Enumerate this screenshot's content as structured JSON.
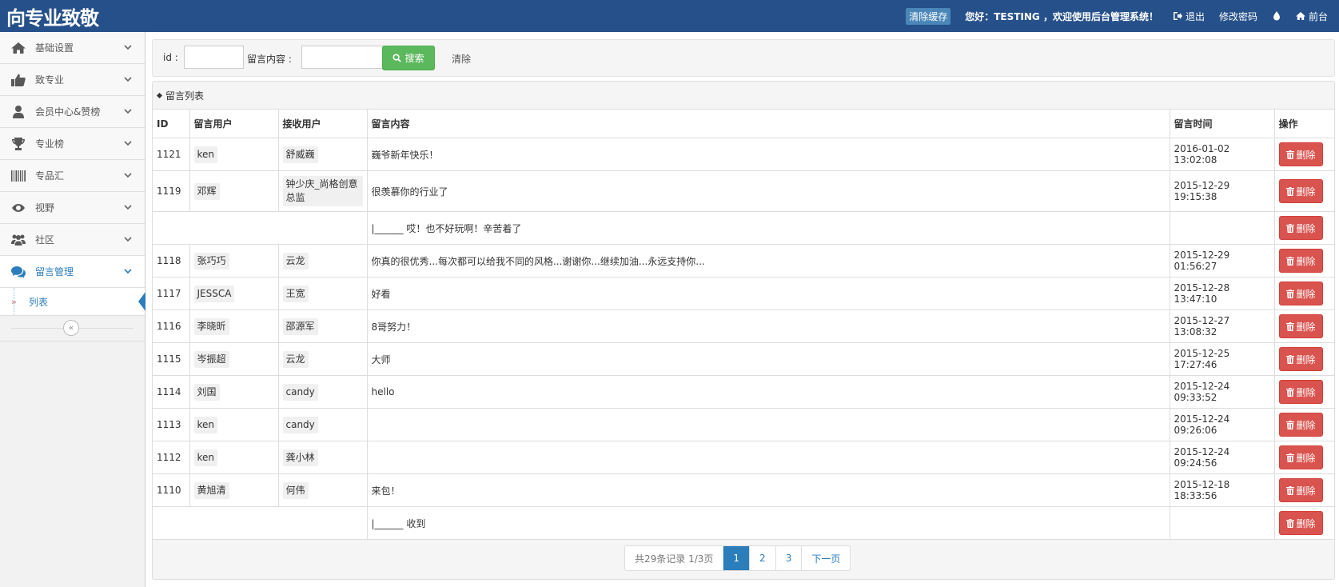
{
  "header": {
    "logo_text": "向专业致敬",
    "clear_cache": "清除缓存",
    "greeting": "您好：TESTING ，欢迎使用后台管理系统！",
    "logout": "退出",
    "change_password": "修改密码",
    "frontend": "前台"
  },
  "sidebar": {
    "items": [
      {
        "label": "基础设置",
        "icon": "home-icon"
      },
      {
        "label": "致专业",
        "icon": "thumbs-up-icon"
      },
      {
        "label": "会员中心&赞榜",
        "icon": "user-icon"
      },
      {
        "label": "专业榜",
        "icon": "trophy-icon"
      },
      {
        "label": "专品汇",
        "icon": "barcode-icon"
      },
      {
        "label": "视野",
        "icon": "eye-icon"
      },
      {
        "label": "社区",
        "icon": "users-icon"
      },
      {
        "label": "留言管理",
        "icon": "comments-icon"
      }
    ],
    "sub_item": "列表",
    "collapse_symbol": "«"
  },
  "search": {
    "id_label": "id :",
    "content_label": "留言内容 :",
    "search_button": "搜索",
    "clear": "清除"
  },
  "panel": {
    "title": "留言列表"
  },
  "table": {
    "headers": [
      "ID",
      "留言用户",
      "接收用户",
      "留言内容",
      "留言时间",
      "操作"
    ],
    "delete_label": "删除",
    "rows": [
      {
        "id": "1121",
        "from": "ken",
        "to": "舒威巍",
        "content": "巍爷新年快乐！",
        "time": "2016-01-02 13:02:08"
      },
      {
        "id": "1119",
        "from": "邓辉",
        "to": "钟少庆_尚格创意总监",
        "content": "很羡慕你的行业了",
        "time": "2015-12-29 19:15:38"
      },
      {
        "id": "",
        "from": "",
        "to": "",
        "content": "|______ 哎！也不好玩啊！辛苦着了",
        "time": ""
      },
      {
        "id": "1118",
        "from": "张巧巧",
        "to": "云龙",
        "content": "你真的很优秀...每次都可以给我不同的风格...谢谢你...继续加油...永远支持你...",
        "time": "2015-12-29 01:56:27"
      },
      {
        "id": "1117",
        "from": "JESSCA",
        "to": "王宽",
        "content": "好看",
        "time": "2015-12-28 13:47:10"
      },
      {
        "id": "1116",
        "from": "李晓昕",
        "to": "邵源军",
        "content": "8哥努力！",
        "time": "2015-12-27 13:08:32"
      },
      {
        "id": "1115",
        "from": "岑振超",
        "to": "云龙",
        "content": "大师",
        "time": "2015-12-25 17:27:46"
      },
      {
        "id": "1114",
        "from": "刘国",
        "to": "candy",
        "content": "hello",
        "time": "2015-12-24 09:33:52"
      },
      {
        "id": "1113",
        "from": "ken",
        "to": "candy",
        "content": "",
        "time": "2015-12-24 09:26:06"
      },
      {
        "id": "1112",
        "from": "ken",
        "to": "龚小林",
        "content": "",
        "time": "2015-12-24 09:24:56"
      },
      {
        "id": "1110",
        "from": "黄旭清",
        "to": "何伟",
        "content": "来包！",
        "time": "2015-12-18 18:33:56"
      },
      {
        "id": "",
        "from": "",
        "to": "",
        "content": "|______ 收到",
        "time": ""
      }
    ]
  },
  "pagination": {
    "summary": "共29条记录 1/3页",
    "pages": [
      "1",
      "2",
      "3"
    ],
    "next": "下一页"
  },
  "colors": {
    "navbar": "#26508a",
    "accent": "#2b7dbc",
    "search_button": "#5cb85c",
    "delete_button": "#d9534f"
  }
}
